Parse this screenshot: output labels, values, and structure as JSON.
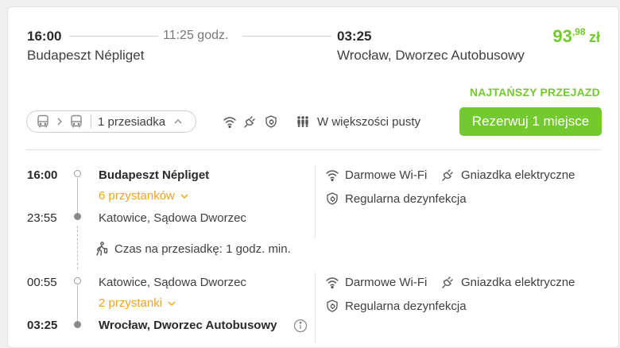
{
  "header": {
    "depart_time": "16:00",
    "depart_city": "Budapeszt Népliget",
    "duration": "11:25 godz.",
    "arrive_time": "03:25",
    "arrive_city": "Wrocław, Dworzec Autobusowy",
    "price_int": "93",
    "price_dec": ",98",
    "currency": "zł",
    "cheapest_label": "NAJTAŃSZY PRZEJAZD"
  },
  "toolbar": {
    "transfers_label": "1 przesiadka",
    "occupancy_label": "W większości pusty",
    "book_label": "Rezerwuj 1 miejsce"
  },
  "segments": [
    {
      "from_time": "16:00",
      "from_name": "Budapeszt Népliget",
      "stops_label": "6 przystanków",
      "to_time": "23:55",
      "to_name": "Katowice, Sądowa Dworzec",
      "amenities": [
        "Darmowe Wi-Fi",
        "Gniazdka elektryczne",
        "Regularna dezynfekcja"
      ]
    },
    {
      "from_time": "00:55",
      "from_name": "Katowice, Sądowa Dworzec",
      "stops_label": "2 przystanki",
      "to_time": "03:25",
      "to_name": "Wrocław, Dworzec Autobusowy",
      "amenities": [
        "Darmowe Wi-Fi",
        "Gniazdka elektryczne",
        "Regularna dezynfekcja"
      ]
    }
  ],
  "transfer": {
    "label": "Czas na przesiadkę: 1 godz. min."
  },
  "colors": {
    "accent": "#73c92d",
    "stops_link": "#f3a21d"
  },
  "icons": [
    "bus-icon",
    "chevron-right-icon",
    "chevron-up-icon",
    "wifi-icon",
    "plug-icon",
    "disinfection-icon",
    "people-icon",
    "walking-icon",
    "info-icon",
    "chevron-down-icon"
  ]
}
